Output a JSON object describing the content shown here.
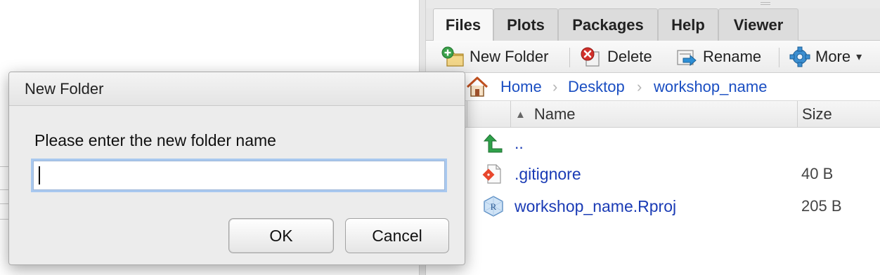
{
  "files_pane": {
    "tabs": [
      {
        "label": "Files"
      },
      {
        "label": "Plots"
      },
      {
        "label": "Packages"
      },
      {
        "label": "Help"
      },
      {
        "label": "Viewer"
      }
    ],
    "active_tab": "Files",
    "toolbar": {
      "new_folder": "New Folder",
      "delete": "Delete",
      "rename": "Rename",
      "more": "More",
      "more_caret": "▾"
    },
    "breadcrumb": [
      "Home",
      "Desktop",
      "workshop_name"
    ],
    "breadcrumb_separator": "›",
    "columns": {
      "name": "Name",
      "size": "Size",
      "sort_indicator": "▲"
    },
    "files": [
      {
        "name": "..",
        "size": "",
        "icon": "parent-directory-icon"
      },
      {
        "name": ".gitignore",
        "size": "40 B",
        "icon": "git-file-icon"
      },
      {
        "name": "workshop_name.Rproj",
        "size": "205 B",
        "icon": "rproj-file-icon"
      }
    ]
  },
  "dialog": {
    "title": "New Folder",
    "prompt": "Please enter the new folder name",
    "input_value": "",
    "ok_label": "OK",
    "cancel_label": "Cancel"
  },
  "colors": {
    "link": "#1a3bb5",
    "focus_ring": "#a8c8ef",
    "dialog_bg": "#ececec"
  }
}
